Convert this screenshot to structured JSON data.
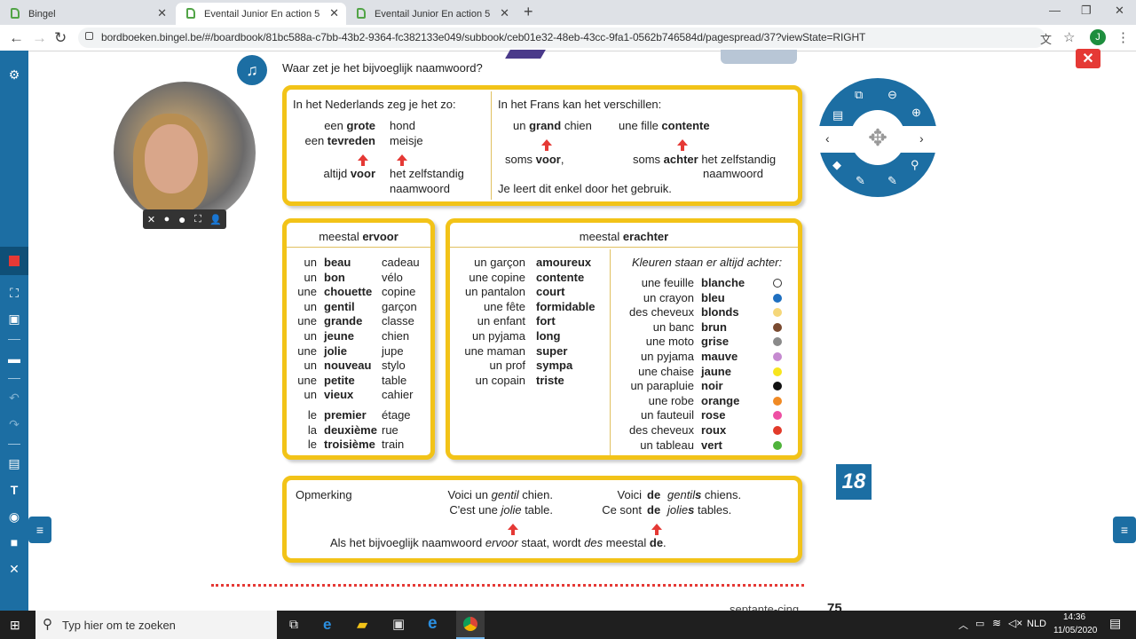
{
  "tabs": [
    {
      "title": "Bingel"
    },
    {
      "title": "Eventail Junior En action 5"
    },
    {
      "title": "Eventail Junior En action 5"
    }
  ],
  "url": "bordboeken.bingel.be/#/boardbook/81bc588a-c7bb-43b2-9364-fc382133e049/subbook/ceb01e32-48eb-43cc-9fa1-0562b746584d/pagespread/37?viewState=RIGHT",
  "profile_initial": "J",
  "question": "Waar zet je het bijvoeglijk naamwoord?",
  "box1": {
    "nl_title": "In het Nederlands zeg je het zo:",
    "nl_rows": [
      [
        "een ",
        "grote",
        "hond"
      ],
      [
        "een ",
        "tevreden",
        "meisje"
      ]
    ],
    "nl_rule": [
      "altijd ",
      "voor",
      "het zelfstandig",
      "naamwoord"
    ],
    "fr_title": "In het Frans kan het verschillen:",
    "fr_a": [
      "un ",
      "grand",
      " chien"
    ],
    "fr_b": [
      "une fille ",
      "contente"
    ],
    "fr_rule_a": [
      "soms ",
      "voor",
      ","
    ],
    "fr_rule_b": [
      "soms ",
      "achter",
      " het zelfstandig",
      "naamwoord"
    ],
    "fr_note": "Je leert dit enkel door het gebruik."
  },
  "box2": {
    "title_pre": "meestal ",
    "title_bold": "ervoor",
    "rows": [
      [
        "un",
        "beau",
        "cadeau"
      ],
      [
        "un",
        "bon",
        "vélo"
      ],
      [
        "une",
        "chouette",
        "copine"
      ],
      [
        "un",
        "gentil",
        "garçon"
      ],
      [
        "une",
        "grande",
        "classe"
      ],
      [
        "un",
        "jeune",
        "chien"
      ],
      [
        "une",
        "jolie",
        "jupe"
      ],
      [
        "un",
        "nouveau",
        "stylo"
      ],
      [
        "une",
        "petite",
        "table"
      ],
      [
        "un",
        "vieux",
        "cahier"
      ]
    ],
    "rows2": [
      [
        "le",
        "premier",
        "étage"
      ],
      [
        "la",
        "deuxième",
        "rue"
      ],
      [
        "le",
        "troisième",
        "train"
      ]
    ]
  },
  "box3": {
    "title_pre": "meestal ",
    "title_bold": "erachter",
    "rows": [
      [
        "un garçon",
        "amoureux"
      ],
      [
        "une copine",
        "contente"
      ],
      [
        "un pantalon",
        "court"
      ],
      [
        "une fête",
        "formidable"
      ],
      [
        "un enfant",
        "fort"
      ],
      [
        "un pyjama",
        "long"
      ],
      [
        "une maman",
        "super"
      ],
      [
        "un prof",
        "sympa"
      ],
      [
        "un copain",
        "triste"
      ]
    ],
    "colors_title": "Kleuren staan er altijd achter:",
    "colors": [
      [
        "une feuille",
        "blanche",
        "#ffffff"
      ],
      [
        "un crayon",
        "bleu",
        "#1e6fc0"
      ],
      [
        "des cheveux",
        "blonds",
        "#f5d77a"
      ],
      [
        "un banc",
        "brun",
        "#7a4a30"
      ],
      [
        "une moto",
        "grise",
        "#8a8a8a"
      ],
      [
        "un pyjama",
        "mauve",
        "#c58ad0"
      ],
      [
        "une chaise",
        "jaune",
        "#f7e51e"
      ],
      [
        "un parapluie",
        "noir",
        "#111111"
      ],
      [
        "une robe",
        "orange",
        "#f08a24"
      ],
      [
        "un fauteuil",
        "rose",
        "#ee4fa3"
      ],
      [
        "des cheveux",
        "roux",
        "#e23a2a"
      ],
      [
        "un tableau",
        "vert",
        "#4fb33b"
      ]
    ]
  },
  "box4": {
    "label": "Opmerking",
    "ex1a": "Voici un ",
    "ex1b": "gentil",
    "ex1c": " chien.",
    "ex2a": "C'est une ",
    "ex2b": "jolie",
    "ex2c": " table.",
    "ex3a": "Voici ",
    "ex3b": "de",
    "ex3c": "gentil",
    "ex3d": "s",
    "ex3e": " chiens.",
    "ex4a": "Ce sont ",
    "ex4b": "de",
    "ex4c": "jolie",
    "ex4d": "s",
    "ex4e": " tables.",
    "rule_a": "Als het bijvoeglijk naamwoord ",
    "rule_b": "ervoor",
    "rule_c": " staat, wordt ",
    "rule_d": "des",
    "rule_e": " meestal ",
    "rule_f": "de",
    "rule_g": "."
  },
  "page_badge": "18",
  "footer_text": "septante-cinq",
  "footer_num": "75",
  "taskbar": {
    "search_placeholder": "Typ hier om te zoeken",
    "lang": "NLD",
    "time": "14:36",
    "date": "11/05/2020"
  }
}
